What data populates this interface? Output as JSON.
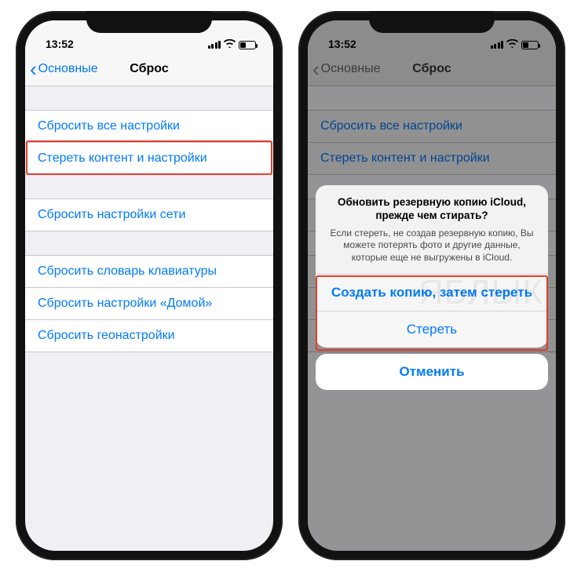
{
  "status": {
    "time": "13:52"
  },
  "nav": {
    "back_label": "Основные",
    "title": "Сброс"
  },
  "groups": [
    {
      "rows": [
        {
          "label": "Сбросить все настройки"
        },
        {
          "label": "Стереть контент и настройки"
        }
      ]
    },
    {
      "rows": [
        {
          "label": "Сбросить настройки сети"
        }
      ]
    },
    {
      "rows": [
        {
          "label": "Сбросить словарь клавиатуры"
        },
        {
          "label": "Сбросить настройки «Домой»"
        },
        {
          "label": "Сбросить геонастройки"
        }
      ]
    }
  ],
  "sheet": {
    "title": "Обновить резервную копию iCloud, прежде чем стирать?",
    "message": "Если стереть, не создав резервную копию, Вы можете потерять фото и другие данные, которые еще не выгружены в iCloud.",
    "backup_then_erase": "Создать копию, затем стереть",
    "erase": "Стереть",
    "cancel": "Отменить"
  },
  "watermark": "ЯБЛЫК"
}
